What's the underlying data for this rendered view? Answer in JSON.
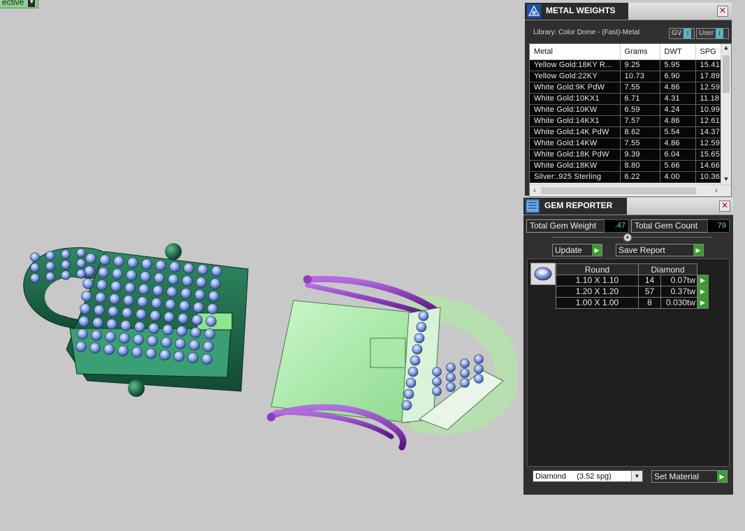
{
  "viewport": {
    "label": "ective"
  },
  "metal_weights": {
    "title": "METAL WEIGHTS",
    "library": "Library: Color Dome - (Fast)-Metal",
    "toggles": [
      {
        "label": "GV"
      },
      {
        "label": "User"
      }
    ],
    "columns": [
      "Metal",
      "Grams",
      "DWT",
      "SPG"
    ],
    "rows": [
      [
        "Yellow Gold:18KY R...",
        "9.25",
        "5.95",
        "15.41"
      ],
      [
        "Yellow Gold:22KY",
        "10.73",
        "6.90",
        "17.89"
      ],
      [
        "White Gold:9K PdW",
        "7.55",
        "4.86",
        "12.59"
      ],
      [
        "White Gold:10KX1",
        "6.71",
        "4.31",
        "11.18"
      ],
      [
        "White Gold:10KW",
        "6.59",
        "4.24",
        "10.99"
      ],
      [
        "White Gold:14KX1",
        "7.57",
        "4.86",
        "12.61"
      ],
      [
        "White Gold:14K PdW",
        "8.62",
        "5.54",
        "14.37"
      ],
      [
        "White Gold:14KW",
        "7.55",
        "4.86",
        "12.59"
      ],
      [
        "White Gold:18K PdW",
        "9.39",
        "6.04",
        "15.65"
      ],
      [
        "White Gold:18KW",
        "8.80",
        "5.66",
        "14.66"
      ],
      [
        "Silver:.925 Sterling",
        "6.22",
        "4.00",
        "10.36"
      ]
    ]
  },
  "gem_reporter": {
    "title": "GEM REPORTER",
    "total_weight_label": "Total Gem Weight",
    "total_weight": ".47",
    "total_count_label": "Total Gem Count",
    "total_count": "79",
    "update_label": "Update",
    "save_label": "Save Report",
    "shape_header": "Round",
    "material_header": "Diamond",
    "gems": [
      {
        "size": "1.10 X 1.10",
        "count": "14",
        "weight": "0.07tw"
      },
      {
        "size": "1.20 X 1.20",
        "count": "57",
        "weight": "0.37tw"
      },
      {
        "size": "1.00 X 1.00",
        "count": "8",
        "weight": "0.030tw"
      }
    ],
    "material_select": "Diamond     (3.52 spg)",
    "set_material_label": "Set Material"
  },
  "colors": {
    "background": "#c8c8c8",
    "part_dark_green": "#1f6a4a",
    "part_light_green": "#a6eea6",
    "prong_purple": "#7a1fa8",
    "gem_blue": "#7f9fe0",
    "go_green": "#3a9b2f",
    "value_cyan": "#5fd4e8"
  },
  "icons": [
    "chevron-down-icon",
    "metal-weights-icon",
    "gem-reporter-icon",
    "close-icon",
    "play-icon",
    "round-gem-icon",
    "scroll-up-icon",
    "scroll-down-icon",
    "scroll-left-icon",
    "scroll-right-icon"
  ]
}
